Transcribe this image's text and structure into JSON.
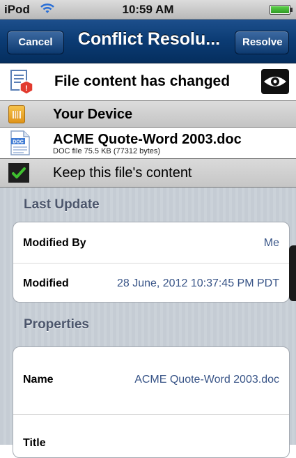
{
  "status_bar": {
    "carrier": "iPod",
    "time": "10:59 AM"
  },
  "nav": {
    "cancel_label": "Cancel",
    "title": "Conflict Resolu...",
    "resolve_label": "Resolve"
  },
  "conflict": {
    "message": "File content has changed"
  },
  "device": {
    "label": "Your Device"
  },
  "file": {
    "name": "ACME Quote-Word 2003.doc",
    "meta": "DOC file  75.5 KB (77312 bytes)",
    "icon_text": "DOC"
  },
  "keep": {
    "label": "Keep this file's content"
  },
  "last_update": {
    "header": "Last Update",
    "rows": [
      {
        "label": "Modified By",
        "value": "Me"
      },
      {
        "label": "Modified",
        "value": "28 June, 2012 10:37:45 PM PDT"
      }
    ]
  },
  "properties": {
    "header": "Properties",
    "rows": [
      {
        "label": "Name",
        "value": "ACME Quote-Word 2003.doc"
      },
      {
        "label": "Title",
        "value": ""
      }
    ]
  },
  "colors": {
    "nav_bar": "#0b3b73",
    "value_text": "#385487",
    "section_header": "#4c566c"
  }
}
